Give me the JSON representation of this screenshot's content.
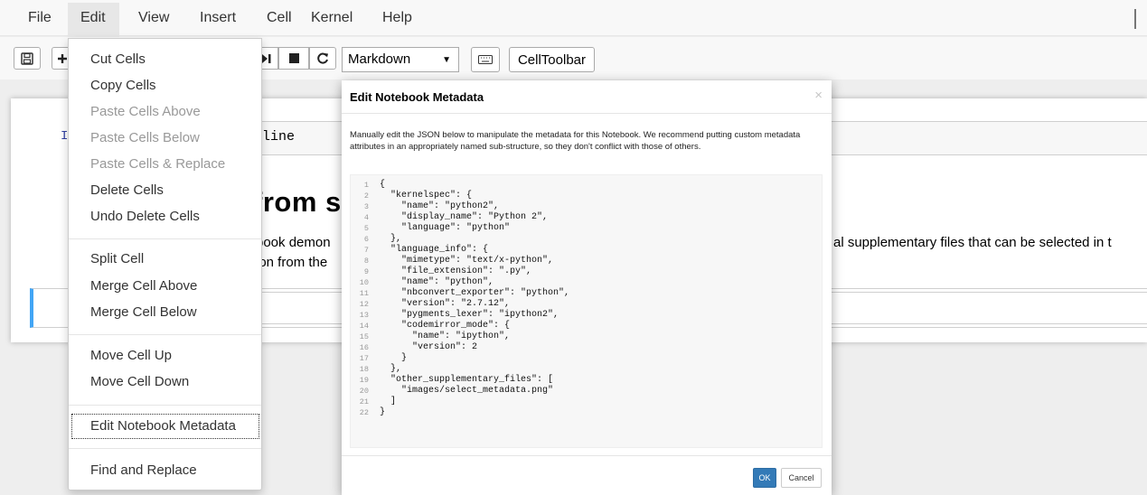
{
  "menubar": {
    "items": [
      "File",
      "Edit",
      "View",
      "Insert",
      "Cell",
      "Kernel",
      "Help"
    ]
  },
  "toolbar": {
    "cell_type": "Markdown",
    "celltoolbar_label": "CellToolbar",
    "icons": [
      "save-icon",
      "plus-icon",
      "step-icon",
      "stop-icon",
      "restart-icon",
      "keyboard-icon"
    ]
  },
  "notebook": {
    "prompt_fragment": "I",
    "code_fragment": "line",
    "heading_fragment": "from s",
    "para_line1_fragment": "book demon",
    "para_line2_fragment": "ion from the",
    "para_right_fragment": "al supplementary files that can be selected in t"
  },
  "edit_menu": {
    "items": [
      {
        "label": "Cut Cells",
        "disabled": false
      },
      {
        "label": "Copy Cells",
        "disabled": false
      },
      {
        "label": "Paste Cells Above",
        "disabled": true
      },
      {
        "label": "Paste Cells Below",
        "disabled": true
      },
      {
        "label": "Paste Cells & Replace",
        "disabled": true
      },
      {
        "label": "Delete Cells",
        "disabled": false
      },
      {
        "label": "Undo Delete Cells",
        "disabled": false
      },
      {
        "label": "Split Cell",
        "disabled": false
      },
      {
        "label": "Merge Cell Above",
        "disabled": false
      },
      {
        "label": "Merge Cell Below",
        "disabled": false
      },
      {
        "label": "Move Cell Up",
        "disabled": false
      },
      {
        "label": "Move Cell Down",
        "disabled": false
      },
      {
        "label": "Edit Notebook Metadata",
        "disabled": false
      },
      {
        "label": "Find and Replace",
        "disabled": false
      }
    ]
  },
  "modal": {
    "title": "Edit Notebook Metadata",
    "close_symbol": "×",
    "description": "Manually edit the JSON below to manipulate the metadata for this Notebook. We recommend putting custom metadata attributes in an appropriately named sub-structure, so they don't conflict with those of others.",
    "json_lines": [
      "{",
      "  \"kernelspec\": {",
      "    \"name\": \"python2\",",
      "    \"display_name\": \"Python 2\",",
      "    \"language\": \"python\"",
      "  },",
      "  \"language_info\": {",
      "    \"mimetype\": \"text/x-python\",",
      "    \"file_extension\": \".py\",",
      "    \"name\": \"python\",",
      "    \"nbconvert_exporter\": \"python\",",
      "    \"version\": \"2.7.12\",",
      "    \"pygments_lexer\": \"ipython2\",",
      "    \"codemirror_mode\": {",
      "      \"name\": \"ipython\",",
      "      \"version\": 2",
      "    }",
      "  },",
      "  \"other_supplementary_files\": [",
      "    \"images/select_metadata.png\"",
      "  ]",
      "}"
    ],
    "ok_label": "OK",
    "cancel_label": "Cancel"
  },
  "colors": {
    "accent_blue": "#337ab7",
    "selected_cell_bar": "#42a5f5"
  }
}
